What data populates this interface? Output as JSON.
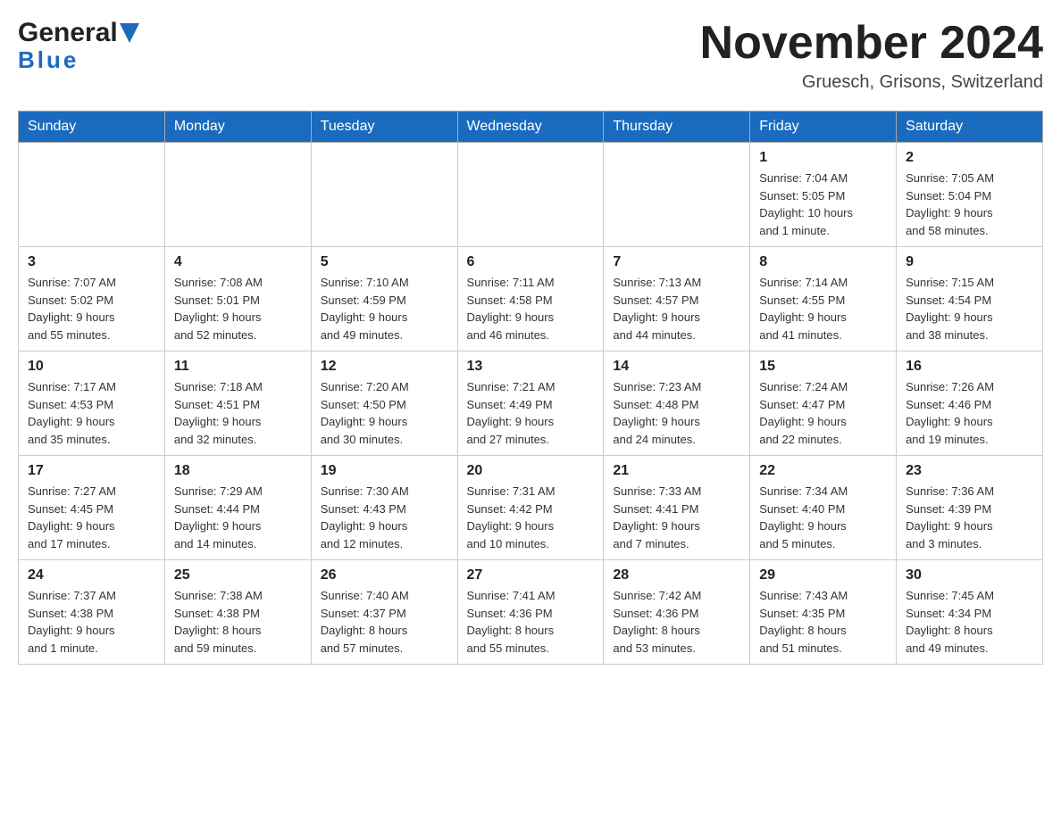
{
  "header": {
    "logo_general": "General",
    "logo_blue": "Blue",
    "title": "November 2024",
    "location": "Gruesch, Grisons, Switzerland"
  },
  "weekdays": [
    "Sunday",
    "Monday",
    "Tuesday",
    "Wednesday",
    "Thursday",
    "Friday",
    "Saturday"
  ],
  "weeks": [
    [
      {
        "day": "",
        "info": ""
      },
      {
        "day": "",
        "info": ""
      },
      {
        "day": "",
        "info": ""
      },
      {
        "day": "",
        "info": ""
      },
      {
        "day": "",
        "info": ""
      },
      {
        "day": "1",
        "info": "Sunrise: 7:04 AM\nSunset: 5:05 PM\nDaylight: 10 hours\nand 1 minute."
      },
      {
        "day": "2",
        "info": "Sunrise: 7:05 AM\nSunset: 5:04 PM\nDaylight: 9 hours\nand 58 minutes."
      }
    ],
    [
      {
        "day": "3",
        "info": "Sunrise: 7:07 AM\nSunset: 5:02 PM\nDaylight: 9 hours\nand 55 minutes."
      },
      {
        "day": "4",
        "info": "Sunrise: 7:08 AM\nSunset: 5:01 PM\nDaylight: 9 hours\nand 52 minutes."
      },
      {
        "day": "5",
        "info": "Sunrise: 7:10 AM\nSunset: 4:59 PM\nDaylight: 9 hours\nand 49 minutes."
      },
      {
        "day": "6",
        "info": "Sunrise: 7:11 AM\nSunset: 4:58 PM\nDaylight: 9 hours\nand 46 minutes."
      },
      {
        "day": "7",
        "info": "Sunrise: 7:13 AM\nSunset: 4:57 PM\nDaylight: 9 hours\nand 44 minutes."
      },
      {
        "day": "8",
        "info": "Sunrise: 7:14 AM\nSunset: 4:55 PM\nDaylight: 9 hours\nand 41 minutes."
      },
      {
        "day": "9",
        "info": "Sunrise: 7:15 AM\nSunset: 4:54 PM\nDaylight: 9 hours\nand 38 minutes."
      }
    ],
    [
      {
        "day": "10",
        "info": "Sunrise: 7:17 AM\nSunset: 4:53 PM\nDaylight: 9 hours\nand 35 minutes."
      },
      {
        "day": "11",
        "info": "Sunrise: 7:18 AM\nSunset: 4:51 PM\nDaylight: 9 hours\nand 32 minutes."
      },
      {
        "day": "12",
        "info": "Sunrise: 7:20 AM\nSunset: 4:50 PM\nDaylight: 9 hours\nand 30 minutes."
      },
      {
        "day": "13",
        "info": "Sunrise: 7:21 AM\nSunset: 4:49 PM\nDaylight: 9 hours\nand 27 minutes."
      },
      {
        "day": "14",
        "info": "Sunrise: 7:23 AM\nSunset: 4:48 PM\nDaylight: 9 hours\nand 24 minutes."
      },
      {
        "day": "15",
        "info": "Sunrise: 7:24 AM\nSunset: 4:47 PM\nDaylight: 9 hours\nand 22 minutes."
      },
      {
        "day": "16",
        "info": "Sunrise: 7:26 AM\nSunset: 4:46 PM\nDaylight: 9 hours\nand 19 minutes."
      }
    ],
    [
      {
        "day": "17",
        "info": "Sunrise: 7:27 AM\nSunset: 4:45 PM\nDaylight: 9 hours\nand 17 minutes."
      },
      {
        "day": "18",
        "info": "Sunrise: 7:29 AM\nSunset: 4:44 PM\nDaylight: 9 hours\nand 14 minutes."
      },
      {
        "day": "19",
        "info": "Sunrise: 7:30 AM\nSunset: 4:43 PM\nDaylight: 9 hours\nand 12 minutes."
      },
      {
        "day": "20",
        "info": "Sunrise: 7:31 AM\nSunset: 4:42 PM\nDaylight: 9 hours\nand 10 minutes."
      },
      {
        "day": "21",
        "info": "Sunrise: 7:33 AM\nSunset: 4:41 PM\nDaylight: 9 hours\nand 7 minutes."
      },
      {
        "day": "22",
        "info": "Sunrise: 7:34 AM\nSunset: 4:40 PM\nDaylight: 9 hours\nand 5 minutes."
      },
      {
        "day": "23",
        "info": "Sunrise: 7:36 AM\nSunset: 4:39 PM\nDaylight: 9 hours\nand 3 minutes."
      }
    ],
    [
      {
        "day": "24",
        "info": "Sunrise: 7:37 AM\nSunset: 4:38 PM\nDaylight: 9 hours\nand 1 minute."
      },
      {
        "day": "25",
        "info": "Sunrise: 7:38 AM\nSunset: 4:38 PM\nDaylight: 8 hours\nand 59 minutes."
      },
      {
        "day": "26",
        "info": "Sunrise: 7:40 AM\nSunset: 4:37 PM\nDaylight: 8 hours\nand 57 minutes."
      },
      {
        "day": "27",
        "info": "Sunrise: 7:41 AM\nSunset: 4:36 PM\nDaylight: 8 hours\nand 55 minutes."
      },
      {
        "day": "28",
        "info": "Sunrise: 7:42 AM\nSunset: 4:36 PM\nDaylight: 8 hours\nand 53 minutes."
      },
      {
        "day": "29",
        "info": "Sunrise: 7:43 AM\nSunset: 4:35 PM\nDaylight: 8 hours\nand 51 minutes."
      },
      {
        "day": "30",
        "info": "Sunrise: 7:45 AM\nSunset: 4:34 PM\nDaylight: 8 hours\nand 49 minutes."
      }
    ]
  ]
}
